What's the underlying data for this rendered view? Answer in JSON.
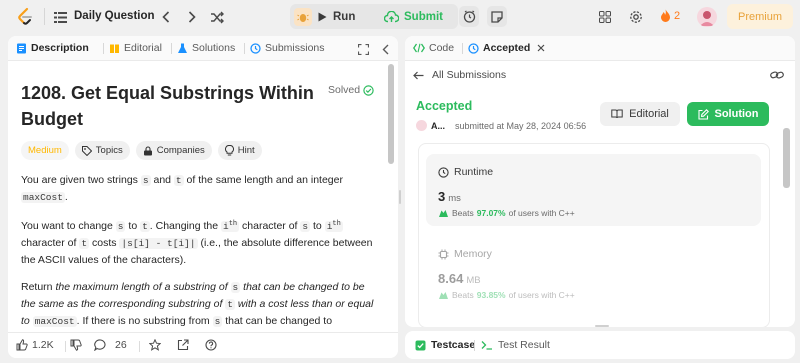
{
  "topbar": {
    "list_label": "Daily Question",
    "run_label": "Run",
    "submit_label": "Submit",
    "streak_count": "2",
    "premium_label": "Premium"
  },
  "left": {
    "tabs": [
      "Description",
      "Editorial",
      "Solutions",
      "Submissions"
    ],
    "title": "1208. Get Equal Substrings Within Budget",
    "solved_label": "Solved",
    "chips": [
      "Medium",
      "Topics",
      "Companies",
      "Hint"
    ],
    "footer": {
      "likes": "1.2K",
      "comments": "26"
    }
  },
  "desc": {
    "p1_a": "You are given two strings ",
    "p1_s": "s",
    "p1_b": " and ",
    "p1_t": "t",
    "p1_c": " of the same length and an integer ",
    "p1_max": "maxCost",
    "p1_d": ".",
    "p2_a": "You want to change ",
    "p2_s": "s",
    "p2_b": " to ",
    "p2_t": "t",
    "p2_c": ". Changing the ",
    "p2_i1": "i",
    "p2_th1": "th",
    "p2_d": " character of ",
    "p2_s2": "s",
    "p2_e": " to ",
    "p2_i2": "i",
    "p2_th2": "th",
    "p2_f": " character of ",
    "p2_t2": "t",
    "p2_g": " costs ",
    "p2_expr": "|s[i] - t[i]|",
    "p2_h": " (i.e., the absolute difference between the ASCII values of the characters).",
    "p3_a": "Return ",
    "p3_em1": "the maximum length of a substring of ",
    "p3_s": "s",
    "p3_em2": " that can be changed to be the same as the corresponding substring of ",
    "p3_t": "t",
    "p3_em3": " with a cost less than or equal to ",
    "p3_max": "maxCost",
    "p3_b": ". If there is no substring from ",
    "p3_s2": "s",
    "p3_c": " that can be changed to"
  },
  "right": {
    "tabs": [
      "Code",
      "Accepted"
    ],
    "back_label": "All Submissions",
    "status": "Accepted",
    "user": "A...",
    "submitted": "submitted at May 28, 2024 06:56",
    "editorial_btn": "Editorial",
    "solution_btn": "Solution",
    "runtime": {
      "label": "Runtime",
      "value": "3",
      "unit": "ms",
      "beats_pre": "Beats",
      "beats_pct": "97.07%",
      "beats_post": "of users with C++"
    },
    "memory": {
      "label": "Memory",
      "value": "8.64",
      "unit": "MB",
      "beats_pre": "Beats",
      "beats_pct": "93.85%",
      "beats_post": "of users with C++"
    }
  },
  "bottom": {
    "tabs": [
      "Testcase",
      "Test Result"
    ]
  },
  "colors": {
    "accent_green": "#2cbb5d",
    "medium": "#ffb800",
    "streak": "#ff7a1a",
    "premium": "#e8a23a"
  }
}
